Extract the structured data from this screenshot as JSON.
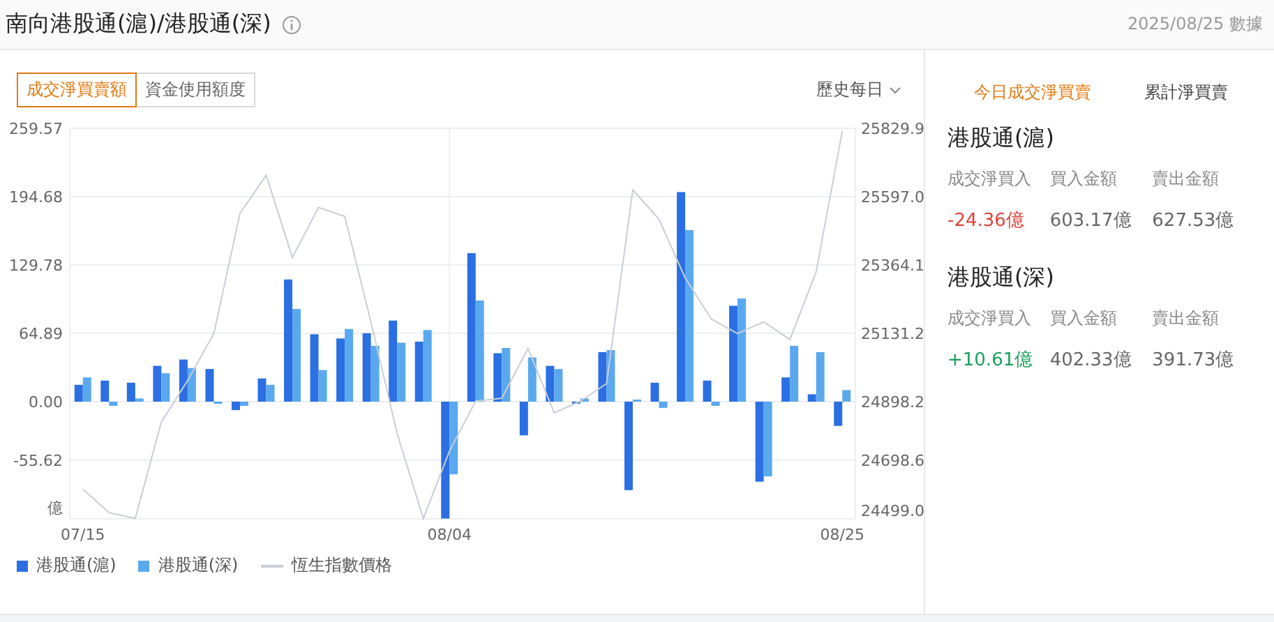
{
  "header": {
    "title": "南向港股通(滬)/港股通(深)",
    "date": "2025/08/25 數據"
  },
  "chart_panel": {
    "toggles": [
      {
        "label": "成交淨買賣額",
        "selected": true
      },
      {
        "label": "資金使用額度",
        "selected": false
      }
    ],
    "period": "歷史每日",
    "chart_data": {
      "type": "bar",
      "ylabel": "億",
      "categories": [
        "07/15",
        null,
        null,
        null,
        null,
        null,
        null,
        null,
        null,
        null,
        null,
        null,
        null,
        null,
        "08/04",
        null,
        null,
        null,
        null,
        null,
        null,
        null,
        null,
        null,
        null,
        null,
        null,
        null,
        null,
        "08/25"
      ],
      "ylim": [
        -111.24,
        259.57
      ],
      "grid": true,
      "yticks": [
        -55.62,
        {
          "value": 0,
          "label": "0.00"
        },
        64.89,
        129.78,
        194.68,
        259.57
      ],
      "series": [
        {
          "name": "港股通(滬)",
          "color": "#2b6fe3",
          "values": [
            16,
            20,
            18,
            34,
            40,
            31,
            -8,
            22,
            116,
            64,
            60,
            65,
            77,
            57,
            -111,
            141,
            46,
            -32,
            34,
            -2,
            47,
            -84,
            18,
            199,
            20,
            91,
            -76,
            23,
            7,
            -23
          ]
        },
        {
          "name": "港股通(深)",
          "color": "#5aa9ef",
          "values": [
            23,
            -4,
            3,
            27,
            32,
            -2,
            -4,
            16,
            88,
            30,
            69,
            53,
            56,
            68,
            -69,
            96,
            51,
            42,
            31,
            3,
            49,
            2,
            -6,
            163,
            -4,
            98,
            -71,
            53,
            47,
            11
          ]
        }
      ]
    },
    "index_line": {
      "chart_data": {
        "type": "line",
        "ylim": [
          24499.0,
          25829.9
        ],
        "yticks": [
          {
            "value": 24499.0,
            "label": "24499.0"
          },
          24698.6,
          24898.2,
          25131.2,
          25364.1,
          {
            "value": 25597.0,
            "label": "25597.0"
          },
          25829.9
        ],
        "series": [
          {
            "name": "恆生指數價格",
            "color": "#c9ced6",
            "values": [
              24600,
              24520,
              24500,
              24830,
              24970,
              25130,
              25540,
              25670,
              25390,
              25560,
              25530,
              25170,
              24790,
              24500,
              24730,
              24900,
              24910,
              25080,
              24860,
              24900,
              24960,
              25620,
              25520,
              25320,
              25180,
              25130,
              25170,
              25110,
              25340,
              25820
            ]
          }
        ]
      }
    }
  },
  "right_panel": {
    "tabs": [
      {
        "label": "今日成交淨買賣",
        "selected": true
      },
      {
        "label": "累計淨買賣",
        "selected": false
      }
    ],
    "sections": [
      {
        "title": "港股通(滬)",
        "columns": [
          {
            "label": "成交淨買入",
            "value": "-24.36億",
            "color": "#e0403a"
          },
          {
            "label": "買入金額",
            "value": "603.17億",
            "color": "#666666"
          },
          {
            "label": "賣出金額",
            "value": "627.53億",
            "color": "#666666"
          }
        ]
      },
      {
        "title": "港股通(深)",
        "columns": [
          {
            "label": "成交淨買入",
            "value": "+10.61億",
            "color": "#19a05a"
          },
          {
            "label": "買入金額",
            "value": "402.33億",
            "color": "#666666"
          },
          {
            "label": "賣出金額",
            "value": "391.73億",
            "color": "#666666"
          }
        ]
      }
    ]
  }
}
